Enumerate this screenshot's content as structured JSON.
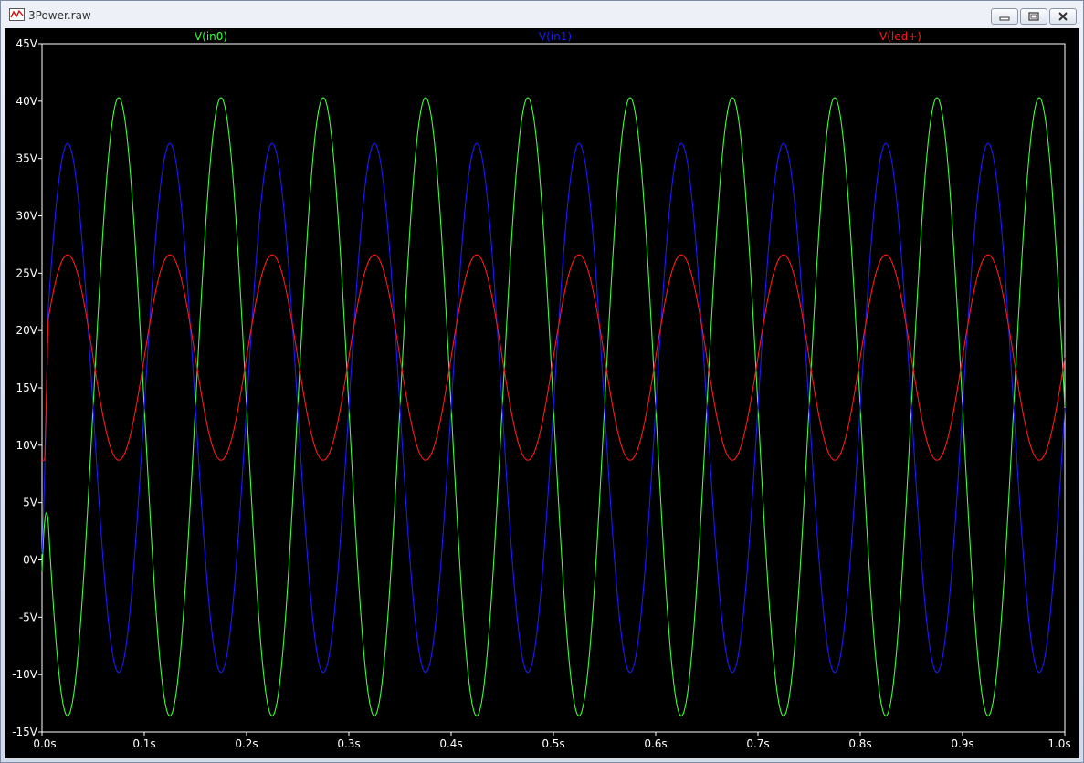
{
  "window": {
    "title": "3Power.raw",
    "icon": "waveform-icon",
    "controls": [
      "minimize-icon",
      "restore-icon",
      "close-icon"
    ]
  },
  "chart_data": {
    "type": "line",
    "title": "",
    "xlabel": "",
    "ylabel": "",
    "xlim": [
      0,
      1.0
    ],
    "ylim": [
      -15,
      45
    ],
    "grid": false,
    "background": "#000000",
    "axis_color": "#ffffff",
    "x_ticks": [
      "0.0s",
      "0.1s",
      "0.2s",
      "0.3s",
      "0.4s",
      "0.5s",
      "0.6s",
      "0.7s",
      "0.8s",
      "0.9s",
      "1.0s"
    ],
    "y_ticks": [
      "-15V",
      "-10V",
      "-5V",
      "0V",
      "5V",
      "10V",
      "15V",
      "20V",
      "25V",
      "30V",
      "35V",
      "40V",
      "45V"
    ],
    "legend_placement": "top",
    "series": [
      {
        "name": "V(in0)",
        "color": "#3cff3c",
        "frequency_hz": 10,
        "min": -13.6,
        "max": 40.3,
        "first_peak_s": 0.075,
        "start_value": -1.0
      },
      {
        "name": "V(in1)",
        "color": "#1a1aff",
        "frequency_hz": 10,
        "min": -9.8,
        "max": 36.3,
        "first_peak_s": 0.025,
        "start_value": 0.5
      },
      {
        "name": "V(led+)",
        "color": "#ff1a1a",
        "frequency_hz": 10,
        "min": 8.7,
        "max": 26.6,
        "first_peak_s": 0.025,
        "start_value": 0.3
      }
    ]
  }
}
